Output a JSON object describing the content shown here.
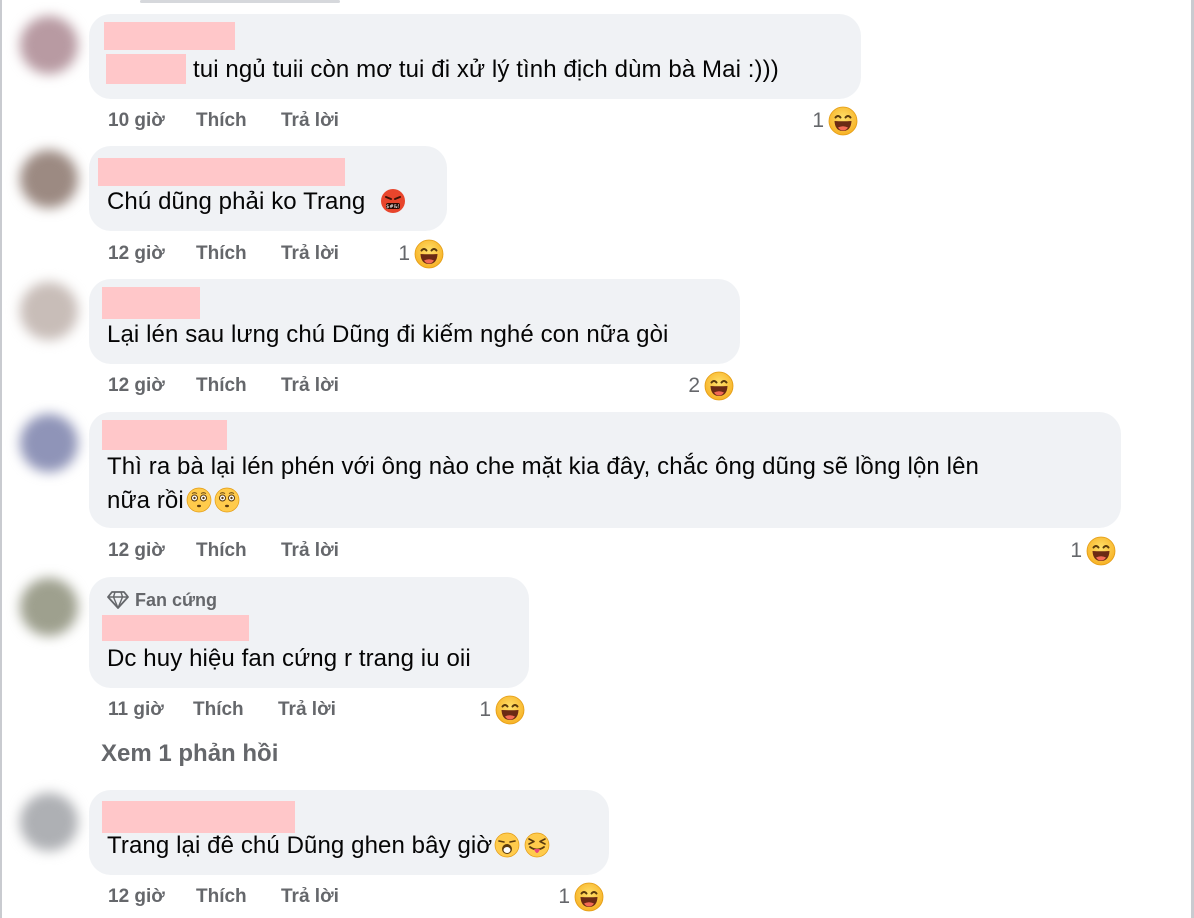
{
  "actions": {
    "like_label": "Thích",
    "reply_label": "Trả lời"
  },
  "comments": [
    {
      "text": "tui ngủ tuii còn mơ tui đi xử lý tình địch dùm bà Mai :)))",
      "time": "10 giờ",
      "reaction_count": "1"
    },
    {
      "text": "Chú dũng phải ko Trang",
      "time": "12 giờ",
      "reaction_count": "1"
    },
    {
      "text": "Lại lén sau lưng chú Dũng đi kiếm nghé con nữa gòi",
      "time": "12 giờ",
      "reaction_count": "2"
    },
    {
      "text_line1": "Thì ra bà lại lén phén với ông nào che mặt kia đây, chắc ông dũng sẽ lồng lộn lên",
      "text_line2": "nữa rồi",
      "time": "12 giờ",
      "reaction_count": "1"
    },
    {
      "badge": "Fan cứng",
      "text": "Dc huy hiệu fan cứng r trang iu oii",
      "time": "11 giờ",
      "reaction_count": "1",
      "view_replies": "Xem 1 phản hồi"
    },
    {
      "text": "Trang lại đê chú Dũng ghen bây giờ",
      "time": "12 giờ",
      "reaction_count": "1"
    }
  ],
  "icons": {
    "reaction": "haha-emoji-icon",
    "angry": "face-with-symbols-icon",
    "flushed": "flushed-face-icon",
    "gasp": "face-with-open-mouth-icon",
    "tongue": "squinting-tongue-icon",
    "badge": "diamond-icon"
  },
  "colors": {
    "bubble": "#f0f2f5",
    "name_mask": "#ffc7c9",
    "meta_text": "#65676b",
    "body_text": "#050505"
  }
}
